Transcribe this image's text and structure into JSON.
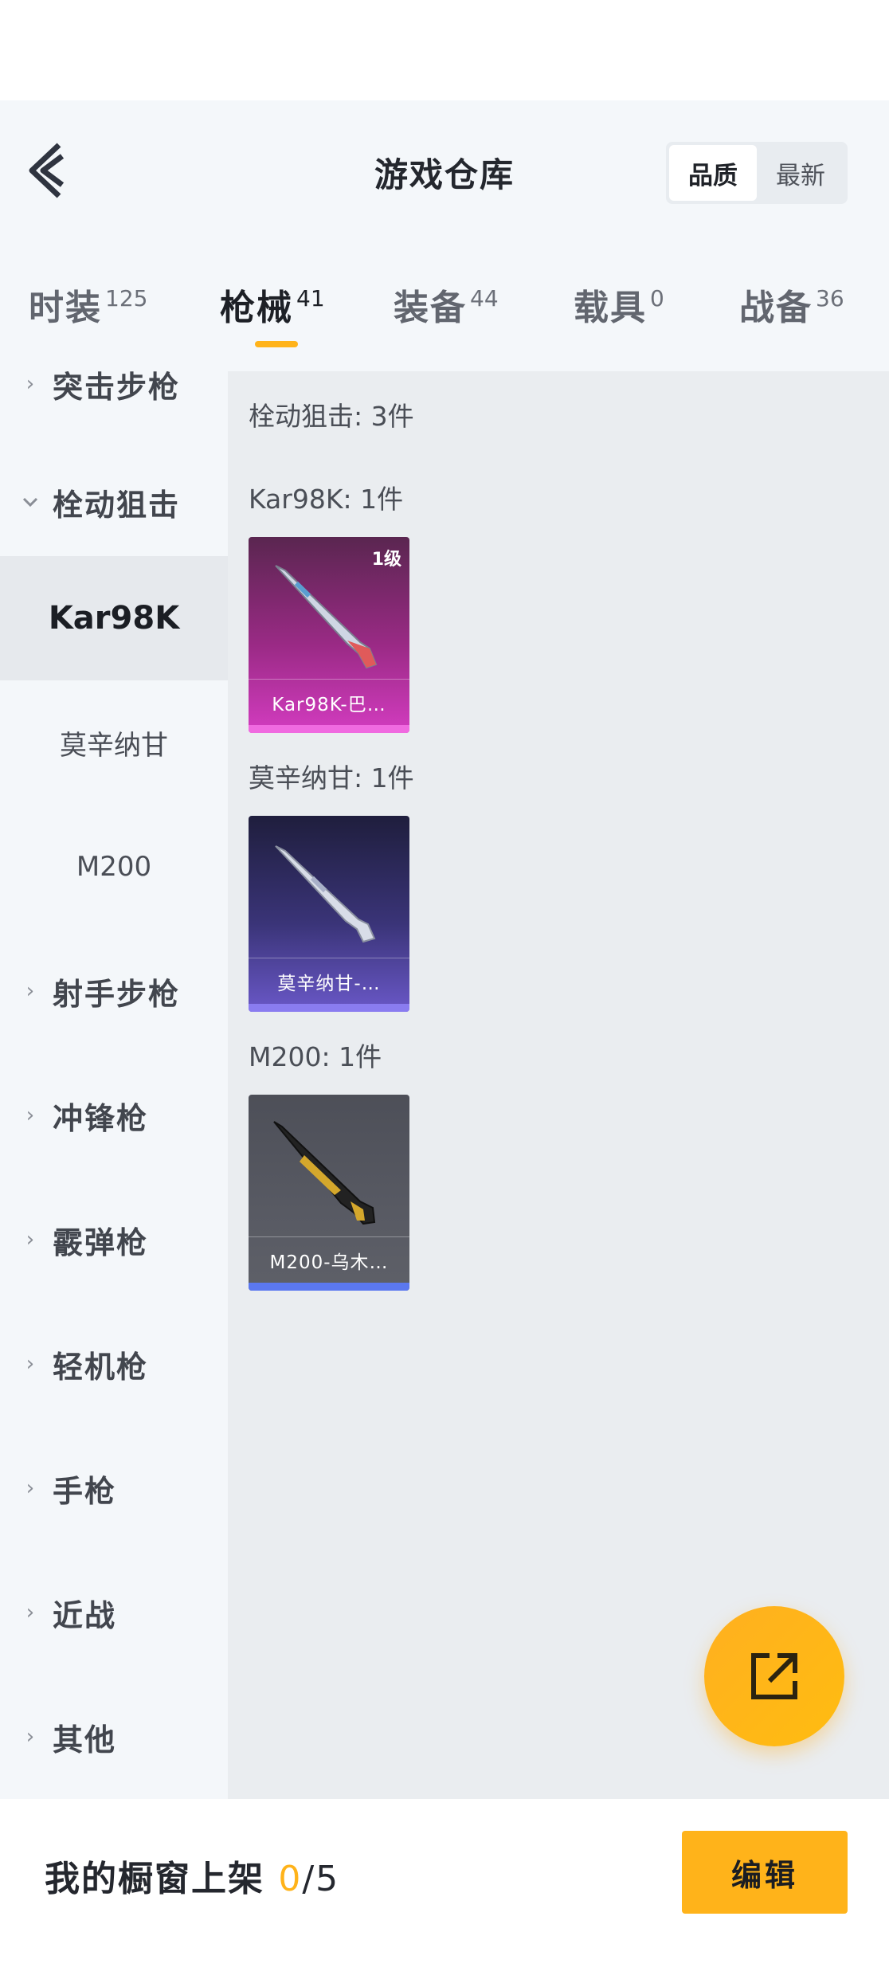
{
  "header": {
    "title": "游戏仓库",
    "sort_options": [
      "品质",
      "最新"
    ],
    "sort_selected": "品质"
  },
  "tabs": [
    {
      "label": "时装",
      "count": "125",
      "active": false
    },
    {
      "label": "枪械",
      "count": "41",
      "active": true
    },
    {
      "label": "装备",
      "count": "44",
      "active": false
    },
    {
      "label": "载具",
      "count": "0",
      "active": false
    },
    {
      "label": "战备",
      "count": "36",
      "active": false
    }
  ],
  "sidebar": {
    "partial_top": "突击步枪",
    "expanded": "栓动狙击",
    "sub_items": [
      "Kar98K",
      "莫辛纳甘",
      "M200"
    ],
    "sub_active": "Kar98K",
    "collapsed": [
      "射手步枪",
      "冲锋枪",
      "霰弹枪",
      "轻机枪",
      "手枪",
      "近战",
      "其他"
    ]
  },
  "content": {
    "category_title": "栓动狙击: 3件",
    "groups": [
      {
        "title": "Kar98K: 1件",
        "item_name": "Kar98K-巴…",
        "level": "1级",
        "rarity": "pink"
      },
      {
        "title": "莫辛纳甘: 1件",
        "item_name": "莫辛纳甘-…",
        "level": "",
        "rarity": "purple"
      },
      {
        "title": "M200: 1件",
        "item_name": "M200-乌木…",
        "level": "",
        "rarity": "gray"
      }
    ]
  },
  "footer": {
    "showcase_label": "我的橱窗上架",
    "showcase_current": "0",
    "showcase_total": "/5",
    "edit_label": "编辑"
  },
  "colors": {
    "accent": "#ffb31a",
    "rarity_pink": "#f06ae0",
    "rarity_purple": "#8a7cf0",
    "rarity_blue": "#5b78f0"
  },
  "icons": [
    "back-arrow-icon",
    "chevron-right-icon",
    "chevron-down-icon",
    "share-export-icon"
  ]
}
